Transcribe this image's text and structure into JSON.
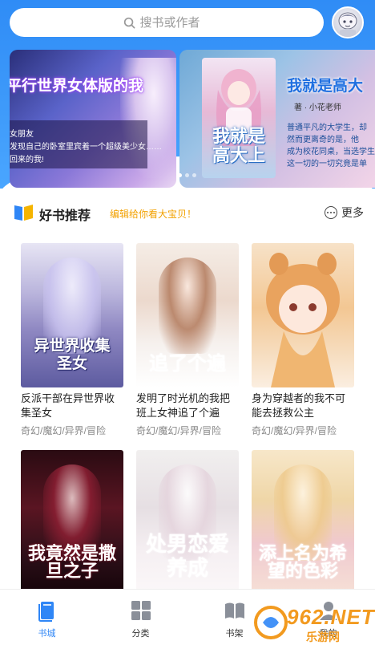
{
  "search": {
    "placeholder": "搜书或作者",
    "icon": "search-icon"
  },
  "header": {
    "avatar_icon": "user-avatar"
  },
  "banners": [
    {
      "title": "平行世界女体版的我",
      "lines": [
        "女朋友",
        "发现自己的卧室里宾着一个超级美少女……",
        "回来的我!"
      ]
    },
    {
      "title": "我就是高大",
      "author": "著 · 小花老师",
      "desc": [
        "普通平凡的大学生，却",
        "然而更离奇的是，他",
        "成为校花同桌，当选学生",
        "这一切的一切究竟是单"
      ],
      "cover_title": "我就是高大上"
    }
  ],
  "section": {
    "title": "好书推荐",
    "subtitle": "编辑给你看大宝贝！",
    "more_label": "更多",
    "icon": "book-open-icon",
    "more_icon": "more-dots-icon"
  },
  "books": [
    {
      "cover_text": "异世界收集圣女",
      "title": "反派干部在异世界收集圣女",
      "tags": "奇幻/魔幻/异界/冒险"
    },
    {
      "cover_text": "追了个遍",
      "title": "发明了时光机的我把班上女神追了个遍",
      "tags": "奇幻/魔幻/异界/冒险"
    },
    {
      "cover_text": "",
      "title": "身为穿越者的我不可能去拯救公主",
      "tags": "奇幻/魔幻/异界/冒险"
    },
    {
      "cover_text": "我竟然是撒旦之子",
      "title": "",
      "tags": ""
    },
    {
      "cover_text": "处男恋爱养成",
      "title": "",
      "tags": ""
    },
    {
      "cover_text": "添上名为希望的色彩",
      "title": "",
      "tags": ""
    }
  ],
  "tabs": [
    {
      "label": "书城",
      "icon": "bookstore-icon",
      "active": true
    },
    {
      "label": "分类",
      "icon": "category-grid-icon",
      "active": false
    },
    {
      "label": "书架",
      "icon": "bookshelf-icon",
      "active": false
    },
    {
      "label": "我的",
      "icon": "profile-icon",
      "active": false
    }
  ],
  "watermark": {
    "text": "962.NET",
    "sub": "乐游网"
  },
  "colors": {
    "accent": "#2f86f6",
    "header_bg": "#3f9bfa",
    "section_sub": "#f2a100"
  }
}
